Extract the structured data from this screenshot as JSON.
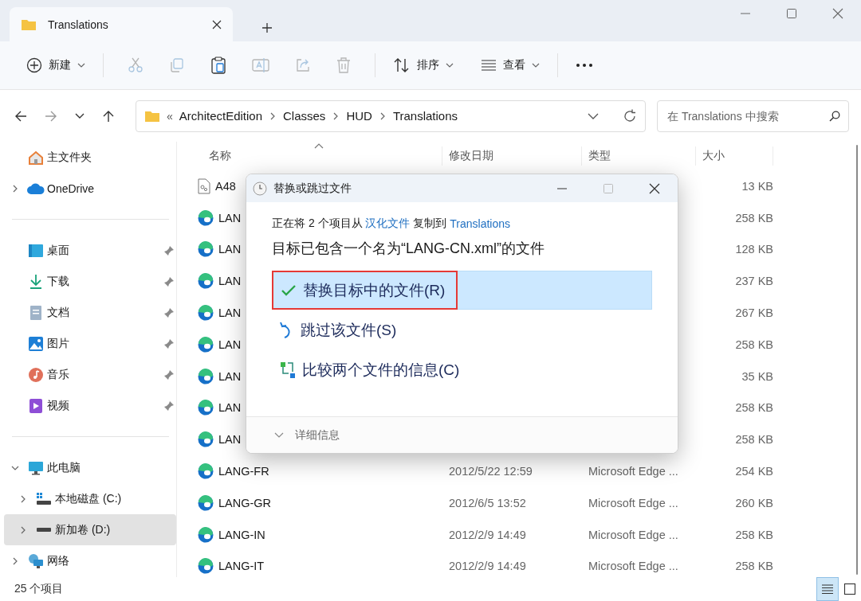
{
  "window": {
    "tab_title": "Translations"
  },
  "toolbar": {
    "new": "新建",
    "sort": "排序",
    "view": "查看"
  },
  "address": {
    "overflow": "«",
    "crumbs": [
      "ArchitectEdition",
      "Classes",
      "HUD",
      "Translations"
    ],
    "search_placeholder": "在 Translations 中搜索"
  },
  "sidebar": {
    "sections": [
      {
        "items": [
          {
            "label": "主文件夹",
            "selected": false
          },
          {
            "label": "OneDrive",
            "selected": false,
            "expanded": false
          }
        ]
      },
      {
        "items": [
          {
            "label": "桌面",
            "selected": false,
            "pinned": true
          },
          {
            "label": "下载",
            "selected": false,
            "pinned": true
          },
          {
            "label": "文档",
            "selected": false,
            "pinned": true
          },
          {
            "label": "图片",
            "selected": false,
            "pinned": true
          },
          {
            "label": "音乐",
            "selected": false,
            "pinned": true
          },
          {
            "label": "视频",
            "selected": false,
            "pinned": true
          }
        ]
      },
      {
        "items": [
          {
            "label": "此电脑",
            "selected": false,
            "expanded": true,
            "children": [
              {
                "label": "本地磁盘 (C:)",
                "selected": false,
                "expanded": false
              },
              {
                "label": "新加卷 (D:)",
                "selected": true,
                "expanded": false
              }
            ]
          },
          {
            "label": "网络",
            "selected": false,
            "expanded": false
          }
        ]
      }
    ]
  },
  "table": {
    "columns": [
      {
        "label": "名称",
        "sorted": true
      },
      {
        "label": "修改日期",
        "sorted": false
      },
      {
        "label": "类型",
        "sorted": false
      },
      {
        "label": "大小",
        "sorted": false
      }
    ],
    "rows": [
      {
        "kind": "document",
        "name": "A48",
        "size": "13 KB"
      },
      {
        "kind": "edge",
        "name": "LAN",
        "size": "258 KB"
      },
      {
        "kind": "edge",
        "name": "LAN",
        "size": "128 KB"
      },
      {
        "kind": "edge",
        "name": "LAN",
        "size": "237 KB"
      },
      {
        "kind": "edge",
        "name": "LAN",
        "size": "267 KB"
      },
      {
        "kind": "edge",
        "name": "LAN",
        "size": "258 KB"
      },
      {
        "kind": "edge",
        "name": "LAN",
        "size": "35 KB"
      },
      {
        "kind": "edge",
        "name": "LAN",
        "size": "258 KB"
      },
      {
        "kind": "edge",
        "name": "LAN",
        "size": "258 KB"
      },
      {
        "kind": "edge",
        "name": "LANG-FR",
        "date": "2012/5/22 12:59",
        "type": "Microsoft Edge ...",
        "size": "254 KB"
      },
      {
        "kind": "edge",
        "name": "LANG-GR",
        "date": "2012/6/5 13:52",
        "type": "Microsoft Edge ...",
        "size": "260 KB"
      },
      {
        "kind": "edge",
        "name": "LANG-IN",
        "date": "2012/2/9 14:49",
        "type": "Microsoft Edge ...",
        "size": "258 KB"
      },
      {
        "kind": "edge",
        "name": "LANG-IT",
        "date": "2012/2/9 14:49",
        "type": "Microsoft Edge ...",
        "size": "258 KB"
      }
    ]
  },
  "status_bar": {
    "count": "25 个项目",
    "views": [
      {
        "kind": "details",
        "selected": true
      },
      {
        "kind": "tiles",
        "selected": false
      }
    ]
  },
  "dialog": {
    "title": "替换或跳过文件",
    "message": [
      {
        "kind": "text",
        "text": "正在将 2 个项目从 "
      },
      {
        "kind": "link",
        "text": "汉化文件"
      },
      {
        "kind": "text",
        "text": " 复制到 "
      },
      {
        "kind": "link",
        "text": "Translations"
      }
    ],
    "heading": "目标已包含一个名为“LANG-CN.xml”的文件",
    "options": [
      {
        "kind": "replace",
        "label": "替换目标中的文件(R)",
        "selected": true,
        "annotated": true
      },
      {
        "kind": "skip",
        "label": "跳过该文件(S)",
        "selected": false,
        "annotated": false
      },
      {
        "kind": "compare",
        "label": "比较两个文件的信息(C)",
        "selected": false,
        "annotated": false
      }
    ],
    "details": {
      "label": "详细信息",
      "expanded": false
    }
  }
}
